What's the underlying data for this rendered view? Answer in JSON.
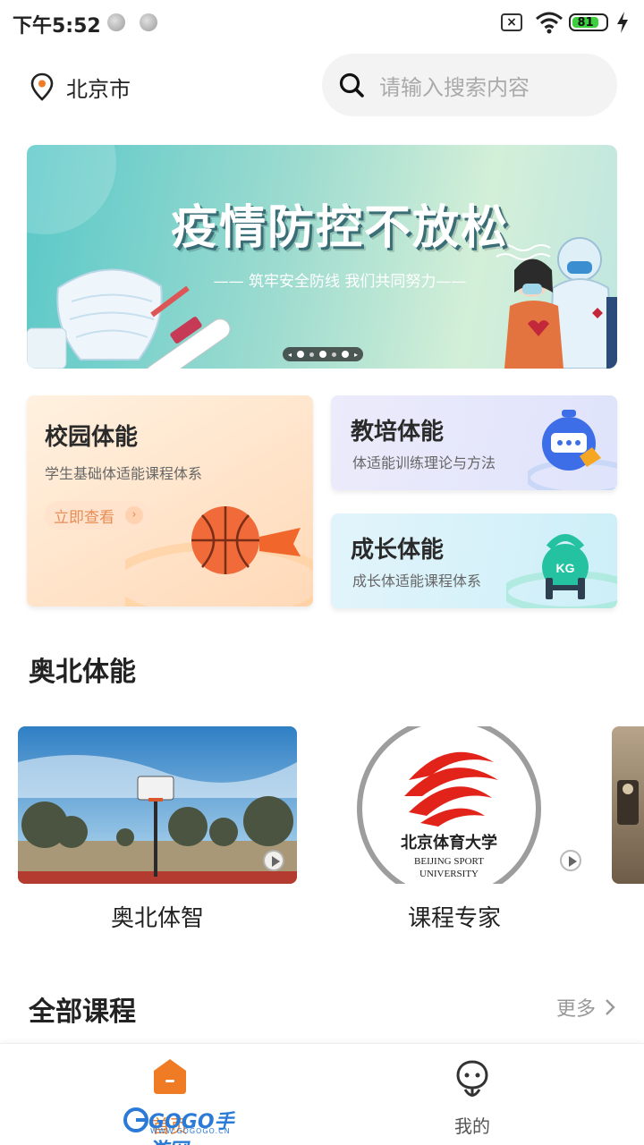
{
  "status_bar": {
    "time": "下午5:52",
    "battery_level": 81,
    "battery_text": "81"
  },
  "header": {
    "city": "北京市",
    "search_placeholder": "请输入搜索内容"
  },
  "banner": {
    "title": "疫情防控不放松",
    "subtitle": "—— 筑牢安全防线  我们共同努力——",
    "active_slide": 2,
    "slide_count": 3
  },
  "categories": {
    "campus": {
      "title": "校园体能",
      "subtitle": "学生基础体适能课程体系",
      "button": "立即查看"
    },
    "coach": {
      "title": "教培体能",
      "subtitle": "体适能训练理论与方法"
    },
    "growth": {
      "title": "成长体能",
      "subtitle": "成长体适能课程体系",
      "badge": "KG"
    }
  },
  "featured": {
    "title": "奥北体能",
    "items": [
      {
        "label": "奥北体智"
      },
      {
        "label": "课程专家",
        "logo_text": "北京体育大学",
        "logo_en_1": "BEIJING SPORT",
        "logo_en_2": "UNIVERSITY"
      }
    ]
  },
  "all_courses": {
    "title": "全部课程",
    "more": "更多"
  },
  "bottom_nav": {
    "home": "首页",
    "mine": "我的"
  },
  "watermark": {
    "text": "GOGO手游网",
    "url": "WWW.GOGOGO.CN"
  },
  "colors": {
    "accent": "#f07b25",
    "banner_start": "#5ac8c8",
    "banner_end": "#d3efd8"
  }
}
